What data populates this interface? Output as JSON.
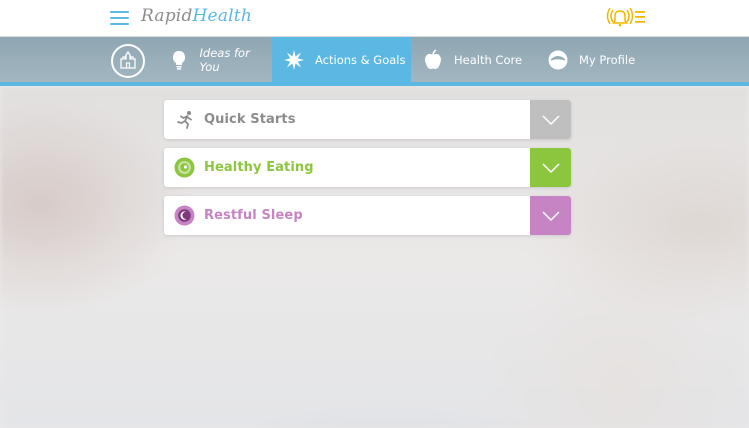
{
  "app": {
    "brand_part1": "Rapid",
    "brand_part2": "Health"
  },
  "colors": {
    "accent": "#5bb8e2",
    "nav_bg": "#97adb8",
    "quick": "#bfbfbf",
    "eating": "#8cc63f",
    "sleep": "#c784c4",
    "alert": "#f5b800"
  },
  "nav": {
    "tabs": [
      {
        "label": "Ideas for You",
        "icon": "lightbulb-icon",
        "active": false
      },
      {
        "label": "Actions & Goals",
        "icon": "starburst-icon",
        "active": true
      },
      {
        "label": "Health Core",
        "icon": "apple-icon",
        "active": false
      },
      {
        "label": "My Profile",
        "icon": "profile-icon",
        "active": false
      }
    ]
  },
  "sections": [
    {
      "title": "Quick Starts",
      "icon": "running-person-icon",
      "color": "#a0a0a0"
    },
    {
      "title": "Healthy Eating",
      "icon": "plate-icon",
      "color": "#8cc63f"
    },
    {
      "title": "Restful Sleep",
      "icon": "moon-icon",
      "color": "#c784c4"
    }
  ]
}
